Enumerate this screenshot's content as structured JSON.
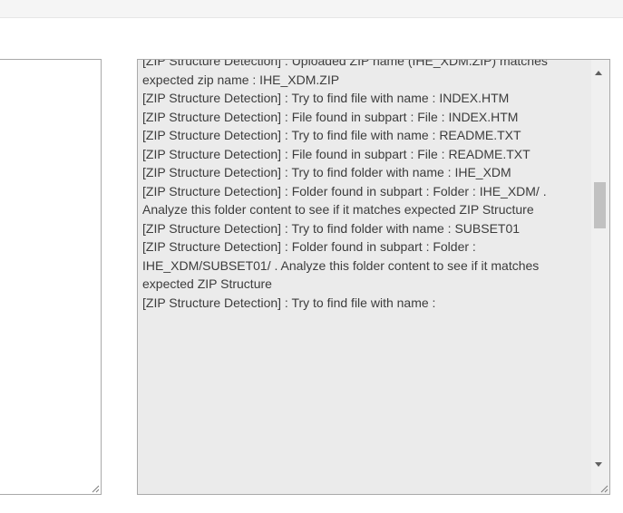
{
  "log": {
    "lines": [
      "[ZIP Structure Detection] : Uploaded ZIP name (IHE_XDM.ZIP) matches expected zip name : IHE_XDM.ZIP",
      "[ZIP Structure Detection] : Try to find file with name : INDEX.HTM",
      "[ZIP Structure Detection] : File found in subpart : File : INDEX.HTM",
      "[ZIP Structure Detection] : Try to find file with name : README.TXT",
      "[ZIP Structure Detection] : File found in subpart : File : README.TXT",
      "[ZIP Structure Detection] : Try to find folder with name : IHE_XDM",
      "[ZIP Structure Detection] : Folder found in subpart : Folder : IHE_XDM/ . Analyze this folder content to see if it matches expected ZIP Structure",
      "[ZIP Structure Detection] : Try to find folder with name : SUBSET01",
      "[ZIP Structure Detection] : Folder found in subpart : Folder : IHE_XDM/SUBSET01/ . Analyze this folder content to see if it matches expected ZIP Structure",
      "[ZIP Structure Detection] : Try to find file with name :"
    ]
  },
  "icons": {
    "scroll_up": "triangle-up-icon",
    "scroll_down": "triangle-down-icon",
    "resize": "resize-grip-icon"
  }
}
